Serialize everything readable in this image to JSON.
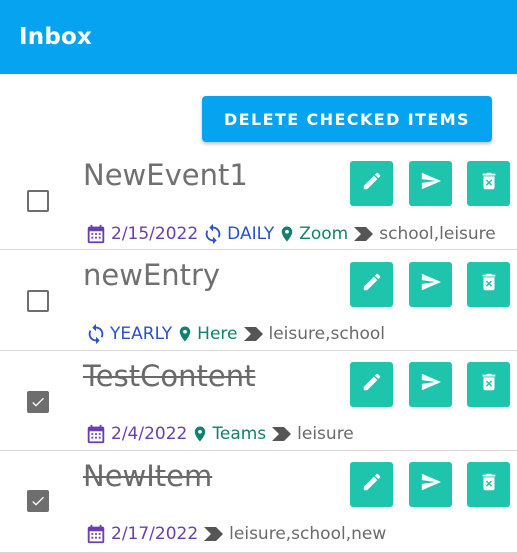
{
  "appbar": {
    "title": "Inbox"
  },
  "actions": {
    "delete_checked_label": "DELETE CHECKED ITEMS"
  },
  "colors": {
    "primary": "#06a4f0",
    "action_teal": "#1fc4ac",
    "date_purple": "#6a3eb0",
    "recurrence_blue": "#2a4fd0",
    "location_green": "#12806d"
  },
  "items": [
    {
      "title": "NewEvent1",
      "checked": false,
      "date": "2/15/2022",
      "recurrence": "DAILY",
      "location": "Zoom",
      "tags": "school,leisure"
    },
    {
      "title": "newEntry",
      "checked": false,
      "recurrence": "YEARLY",
      "location": "Here",
      "tags": "leisure,school"
    },
    {
      "title": "TestContent",
      "checked": true,
      "date": "2/4/2022",
      "location": "Teams",
      "tags": "leisure"
    },
    {
      "title": "NewItem",
      "checked": true,
      "date": "2/17/2022",
      "tags": "leisure,school,new"
    }
  ],
  "icons": {
    "edit": "pencil-icon",
    "send": "send-icon",
    "delete": "trash-icon",
    "date": "calendar-icon",
    "recurrence": "repeat-icon",
    "location": "location-pin-icon",
    "tags": "label-tag-icon",
    "checked": "checkmark-icon"
  }
}
